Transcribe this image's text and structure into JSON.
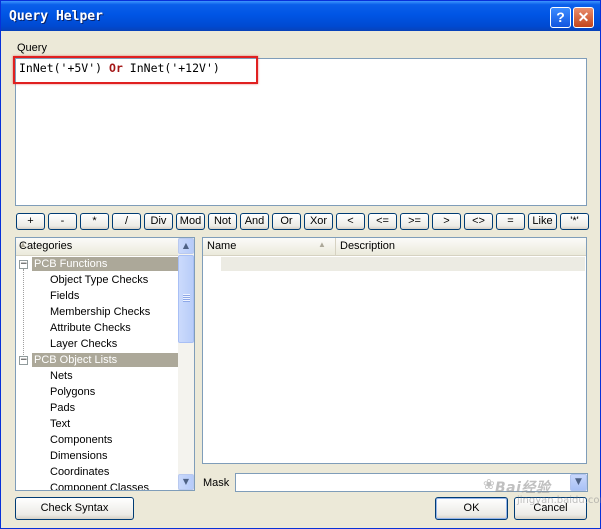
{
  "window": {
    "title": "Query Helper",
    "help_glyph": "?",
    "close_glyph": "✕"
  },
  "query": {
    "label": "Query",
    "text_parts": [
      "InNet('+5V') ",
      "Or",
      " InNet('+12V')"
    ]
  },
  "operators": [
    "+",
    "-",
    "*",
    "/",
    "Div",
    "Mod",
    "Not",
    "And",
    "Or",
    "Xor",
    "<",
    "<=",
    ">=",
    ">",
    "<>",
    "=",
    "Like",
    "'*'"
  ],
  "categories": {
    "header": "Categories",
    "groups": [
      {
        "label": "PCB Functions",
        "expander": "−",
        "children": [
          "Object Type Checks",
          "Fields",
          "Membership Checks",
          "Attribute Checks",
          "Layer Checks"
        ]
      },
      {
        "label": "PCB Object Lists",
        "expander": "−",
        "children": [
          "Nets",
          "Polygons",
          "Pads",
          "Text",
          "Components",
          "Dimensions",
          "Coordinates",
          "Component Classes"
        ]
      }
    ]
  },
  "list": {
    "columns": [
      "Name",
      "Description"
    ]
  },
  "mask": {
    "label": "Mask",
    "value": ""
  },
  "buttons": {
    "check_syntax": "Check Syntax",
    "ok": "OK",
    "cancel": "Cancel"
  },
  "watermark": {
    "line1": "Bai经验",
    "line2": "jingyan.baidu.com"
  },
  "icons": {
    "help": "help-icon",
    "close": "close-icon",
    "expander": "collapse-icon",
    "combo": "chevron-down-icon"
  }
}
